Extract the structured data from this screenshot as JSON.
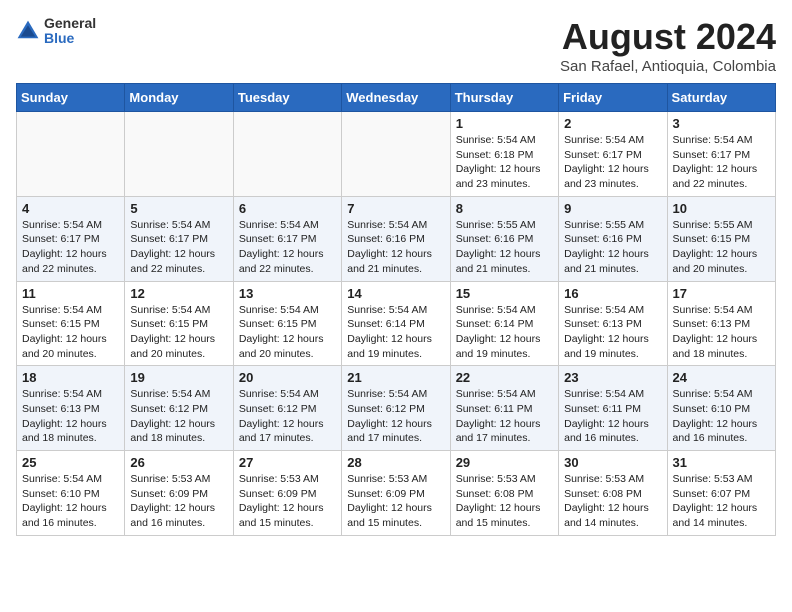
{
  "header": {
    "logo_general": "General",
    "logo_blue": "Blue",
    "month": "August 2024",
    "location": "San Rafael, Antioquia, Colombia"
  },
  "weekdays": [
    "Sunday",
    "Monday",
    "Tuesday",
    "Wednesday",
    "Thursday",
    "Friday",
    "Saturday"
  ],
  "weeks": [
    [
      {
        "day": "",
        "info": ""
      },
      {
        "day": "",
        "info": ""
      },
      {
        "day": "",
        "info": ""
      },
      {
        "day": "",
        "info": ""
      },
      {
        "day": "1",
        "info": "Sunrise: 5:54 AM\nSunset: 6:18 PM\nDaylight: 12 hours\nand 23 minutes."
      },
      {
        "day": "2",
        "info": "Sunrise: 5:54 AM\nSunset: 6:17 PM\nDaylight: 12 hours\nand 23 minutes."
      },
      {
        "day": "3",
        "info": "Sunrise: 5:54 AM\nSunset: 6:17 PM\nDaylight: 12 hours\nand 22 minutes."
      }
    ],
    [
      {
        "day": "4",
        "info": "Sunrise: 5:54 AM\nSunset: 6:17 PM\nDaylight: 12 hours\nand 22 minutes."
      },
      {
        "day": "5",
        "info": "Sunrise: 5:54 AM\nSunset: 6:17 PM\nDaylight: 12 hours\nand 22 minutes."
      },
      {
        "day": "6",
        "info": "Sunrise: 5:54 AM\nSunset: 6:17 PM\nDaylight: 12 hours\nand 22 minutes."
      },
      {
        "day": "7",
        "info": "Sunrise: 5:54 AM\nSunset: 6:16 PM\nDaylight: 12 hours\nand 21 minutes."
      },
      {
        "day": "8",
        "info": "Sunrise: 5:55 AM\nSunset: 6:16 PM\nDaylight: 12 hours\nand 21 minutes."
      },
      {
        "day": "9",
        "info": "Sunrise: 5:55 AM\nSunset: 6:16 PM\nDaylight: 12 hours\nand 21 minutes."
      },
      {
        "day": "10",
        "info": "Sunrise: 5:55 AM\nSunset: 6:15 PM\nDaylight: 12 hours\nand 20 minutes."
      }
    ],
    [
      {
        "day": "11",
        "info": "Sunrise: 5:54 AM\nSunset: 6:15 PM\nDaylight: 12 hours\nand 20 minutes."
      },
      {
        "day": "12",
        "info": "Sunrise: 5:54 AM\nSunset: 6:15 PM\nDaylight: 12 hours\nand 20 minutes."
      },
      {
        "day": "13",
        "info": "Sunrise: 5:54 AM\nSunset: 6:15 PM\nDaylight: 12 hours\nand 20 minutes."
      },
      {
        "day": "14",
        "info": "Sunrise: 5:54 AM\nSunset: 6:14 PM\nDaylight: 12 hours\nand 19 minutes."
      },
      {
        "day": "15",
        "info": "Sunrise: 5:54 AM\nSunset: 6:14 PM\nDaylight: 12 hours\nand 19 minutes."
      },
      {
        "day": "16",
        "info": "Sunrise: 5:54 AM\nSunset: 6:13 PM\nDaylight: 12 hours\nand 19 minutes."
      },
      {
        "day": "17",
        "info": "Sunrise: 5:54 AM\nSunset: 6:13 PM\nDaylight: 12 hours\nand 18 minutes."
      }
    ],
    [
      {
        "day": "18",
        "info": "Sunrise: 5:54 AM\nSunset: 6:13 PM\nDaylight: 12 hours\nand 18 minutes."
      },
      {
        "day": "19",
        "info": "Sunrise: 5:54 AM\nSunset: 6:12 PM\nDaylight: 12 hours\nand 18 minutes."
      },
      {
        "day": "20",
        "info": "Sunrise: 5:54 AM\nSunset: 6:12 PM\nDaylight: 12 hours\nand 17 minutes."
      },
      {
        "day": "21",
        "info": "Sunrise: 5:54 AM\nSunset: 6:12 PM\nDaylight: 12 hours\nand 17 minutes."
      },
      {
        "day": "22",
        "info": "Sunrise: 5:54 AM\nSunset: 6:11 PM\nDaylight: 12 hours\nand 17 minutes."
      },
      {
        "day": "23",
        "info": "Sunrise: 5:54 AM\nSunset: 6:11 PM\nDaylight: 12 hours\nand 16 minutes."
      },
      {
        "day": "24",
        "info": "Sunrise: 5:54 AM\nSunset: 6:10 PM\nDaylight: 12 hours\nand 16 minutes."
      }
    ],
    [
      {
        "day": "25",
        "info": "Sunrise: 5:54 AM\nSunset: 6:10 PM\nDaylight: 12 hours\nand 16 minutes."
      },
      {
        "day": "26",
        "info": "Sunrise: 5:53 AM\nSunset: 6:09 PM\nDaylight: 12 hours\nand 16 minutes."
      },
      {
        "day": "27",
        "info": "Sunrise: 5:53 AM\nSunset: 6:09 PM\nDaylight: 12 hours\nand 15 minutes."
      },
      {
        "day": "28",
        "info": "Sunrise: 5:53 AM\nSunset: 6:09 PM\nDaylight: 12 hours\nand 15 minutes."
      },
      {
        "day": "29",
        "info": "Sunrise: 5:53 AM\nSunset: 6:08 PM\nDaylight: 12 hours\nand 15 minutes."
      },
      {
        "day": "30",
        "info": "Sunrise: 5:53 AM\nSunset: 6:08 PM\nDaylight: 12 hours\nand 14 minutes."
      },
      {
        "day": "31",
        "info": "Sunrise: 5:53 AM\nSunset: 6:07 PM\nDaylight: 12 hours\nand 14 minutes."
      }
    ]
  ]
}
